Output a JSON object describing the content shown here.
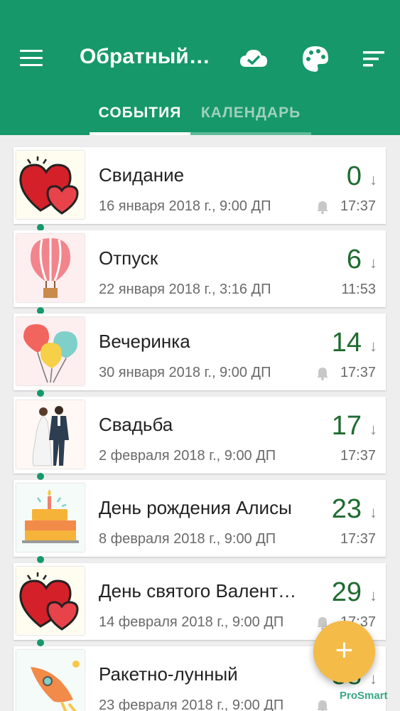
{
  "app": {
    "title": "Обратный…",
    "icons": [
      "menu-icon",
      "cloud-check-icon",
      "palette-icon",
      "sort-icon"
    ]
  },
  "tabs": [
    {
      "label": "СОБЫТИЯ",
      "active": true
    },
    {
      "label": "КАЛЕНДАРЬ",
      "active": false
    }
  ],
  "events": [
    {
      "title": "Свидание",
      "date": "16 января 2018 г., 9:00 ДП",
      "count": "0",
      "time": "17:37",
      "bell": true,
      "image": "hearts"
    },
    {
      "title": "Отпуск",
      "date": "22 января 2018 г., 3:16 ДП",
      "count": "6",
      "time": "11:53",
      "bell": false,
      "image": "balloon"
    },
    {
      "title": "Вечеринка",
      "date": "30 января 2018 г., 9:00 ДП",
      "count": "14",
      "time": "17:37",
      "bell": true,
      "image": "party-balloons"
    },
    {
      "title": "Свадьба",
      "date": "2 февраля 2018 г., 9:00 ДП",
      "count": "17",
      "time": "17:37",
      "bell": false,
      "image": "wedding"
    },
    {
      "title": "День рождения Алисы",
      "date": "8 февраля 2018 г., 9:00 ДП",
      "count": "23",
      "time": "17:37",
      "bell": false,
      "image": "cake"
    },
    {
      "title": "День святого Валент…",
      "date": "14 февраля 2018 г., 9:00 ДП",
      "count": "29",
      "time": "17:37",
      "bell": true,
      "image": "hearts"
    },
    {
      "title": "Ракетно-лунный",
      "date": "23 февраля 2018 г., 9:00 ДП",
      "count": "38",
      "time": "",
      "bell": true,
      "image": "rocket"
    }
  ],
  "arrow": "↓",
  "fab_label": "+",
  "watermark": "ProSmart",
  "colors": {
    "primary": "#16986a",
    "accent": "#f4bb48",
    "count": "#1e6b2f"
  }
}
